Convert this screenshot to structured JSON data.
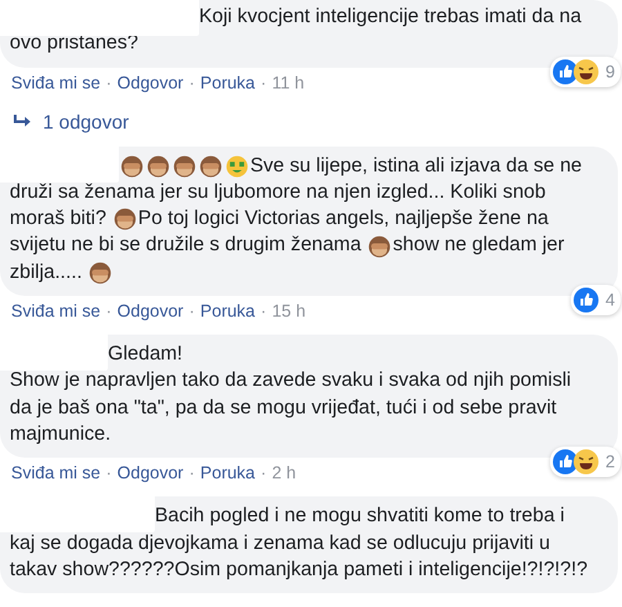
{
  "comments": [
    {
      "lines": [
        [
          {
            "kind": "text",
            "text": "Koji kvocjent inteligencije trebas imati da na"
          }
        ],
        [
          {
            "kind": "text",
            "text": "ovo pristanes?"
          }
        ]
      ],
      "reactions": [
        {
          "kind": "like"
        },
        {
          "kind": "haha"
        }
      ],
      "reaction_count": "9",
      "actions": [
        "Sviđa mi se",
        "Odgovor",
        "Poruka"
      ],
      "separator": "·",
      "time": "11 h",
      "replies": "1 odgovor"
    },
    {
      "lines": [
        [
          {
            "kind": "monkey"
          },
          {
            "kind": "monkey"
          },
          {
            "kind": "monkey"
          },
          {
            "kind": "monkey"
          },
          {
            "kind": "money"
          },
          {
            "kind": "text",
            "text": "Sve su lijepe, istina ali izjava da se ne"
          }
        ],
        [
          {
            "kind": "text",
            "text": "druži sa ženama jer su ljubomore na njen izgled... Koliki snob"
          }
        ],
        [
          {
            "kind": "text",
            "text": "moraš biti? "
          },
          {
            "kind": "monkey"
          },
          {
            "kind": "text",
            "text": "Po toj logici Victorias angels, najljepše žene na"
          }
        ],
        [
          {
            "kind": "text",
            "text": "svijetu ne bi se družile s drugim ženama "
          },
          {
            "kind": "monkey"
          },
          {
            "kind": "text",
            "text": "show ne gledam jer"
          }
        ],
        [
          {
            "kind": "text",
            "text": "zbilja..... "
          },
          {
            "kind": "monkey"
          }
        ]
      ],
      "reactions": [
        {
          "kind": "like"
        }
      ],
      "reaction_count": "4",
      "actions": [
        "Sviđa mi se",
        "Odgovor",
        "Poruka"
      ],
      "separator": "·",
      "time": "15 h"
    },
    {
      "lines": [
        [
          {
            "kind": "text",
            "text": "Gledam!"
          }
        ],
        [
          {
            "kind": "text",
            "text": "Show je napravljen tako da zavede svaku i svaka od njih pomisli"
          }
        ],
        [
          {
            "kind": "text",
            "text": "da je baš ona \"ta\", pa da se mogu vrijeđat, tući i od sebe pravit"
          }
        ],
        [
          {
            "kind": "text",
            "text": "majmunice."
          }
        ]
      ],
      "reactions": [
        {
          "kind": "like"
        },
        {
          "kind": "haha"
        }
      ],
      "reaction_count": "2",
      "actions": [
        "Sviđa mi se",
        "Odgovor",
        "Poruka"
      ],
      "separator": "·",
      "time": "2 h"
    },
    {
      "lines": [
        [
          {
            "kind": "text",
            "text": "Bacih pogled i ne mogu shvatiti kome to treba i"
          }
        ],
        [
          {
            "kind": "text",
            "text": "kaj se dogada djevojkama i zenama kad se odlucuju prijaviti u"
          }
        ],
        [
          {
            "kind": "text",
            "text": "takav show??????Osim pomanjkanja pameti i inteligencije!?!?!?!?"
          }
        ]
      ]
    }
  ]
}
